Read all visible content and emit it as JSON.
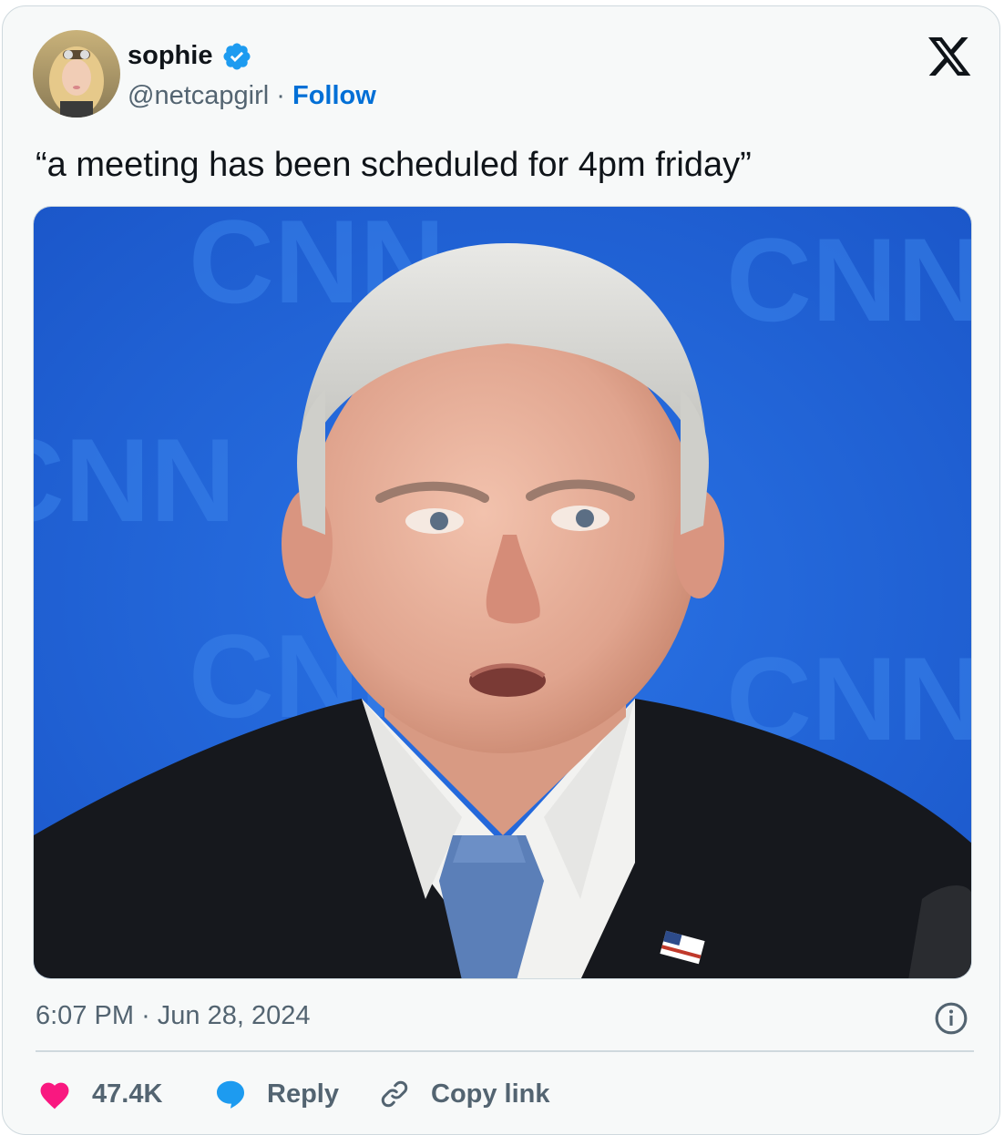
{
  "author": {
    "name": "sophie",
    "handle": "@netcapgirl",
    "separator": "·",
    "follow_label": "Follow",
    "verified": true
  },
  "tweet": {
    "text": "“a meeting has been scheduled for 4pm friday”",
    "time": "6:07 PM",
    "date_separator": "·",
    "date": "Jun 28, 2024"
  },
  "media": {
    "background_text": "CNN"
  },
  "actions": {
    "likes_count": "47.4K",
    "reply_label": "Reply",
    "copy_label": "Copy link"
  },
  "icons": {
    "brand": "x-logo-icon",
    "verified": "verified-badge-icon",
    "info": "info-icon",
    "like": "heart-icon",
    "reply": "speech-bubble-icon",
    "copy": "link-icon"
  },
  "colors": {
    "accent": "#1d9bf0",
    "follow": "#006fd6",
    "like": "#f91880",
    "muted": "#536471",
    "text": "#0f1419",
    "card_bg": "#f7f9f9",
    "media_bg": "#1f62d6"
  }
}
